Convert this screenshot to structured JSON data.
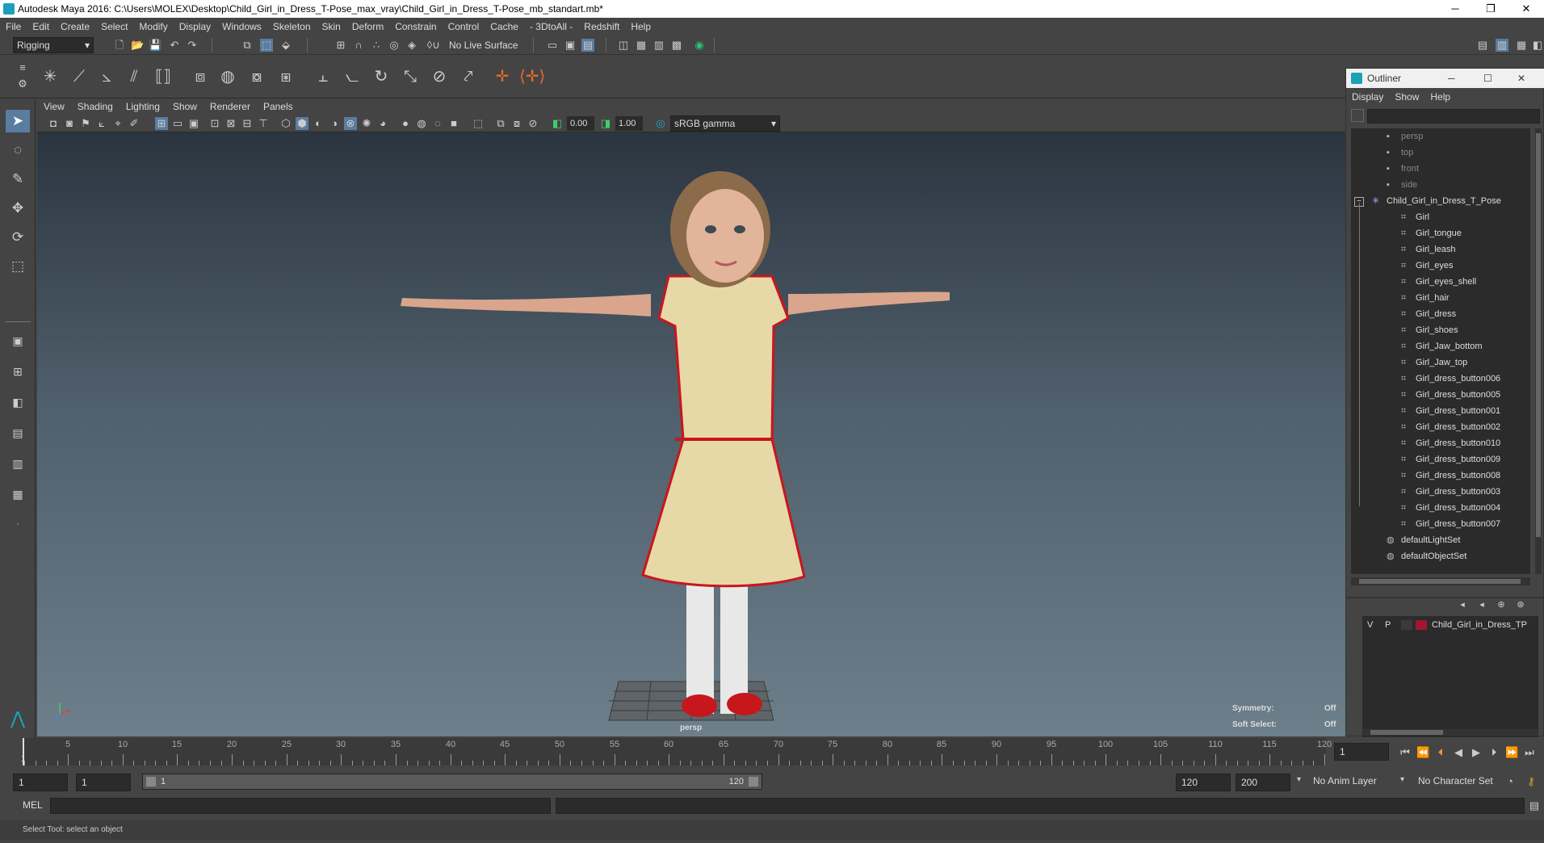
{
  "window": {
    "title": "Autodesk Maya 2016: C:\\Users\\MOLEX\\Desktop\\Child_Girl_in_Dress_T-Pose_max_vray\\Child_Girl_in_Dress_T-Pose_mb_standart.mb*",
    "minimize": "─",
    "restore": "❐",
    "close": "✕"
  },
  "menubar": [
    "File",
    "Edit",
    "Create",
    "Select",
    "Modify",
    "Display",
    "Windows",
    "Skeleton",
    "Skin",
    "Deform",
    "Constrain",
    "Control",
    "Cache",
    "- 3DtoAll -",
    "Redshift",
    "Help"
  ],
  "status": {
    "mode": "Rigging",
    "live_surface": "No Live Surface"
  },
  "panel_menu": [
    "View",
    "Shading",
    "Lighting",
    "Show",
    "Renderer",
    "Panels"
  ],
  "panel_toolbar": {
    "exposure": "0.00",
    "gamma": "1.00",
    "colorspace": "sRGB gamma"
  },
  "viewport": {
    "camera_label": "persp",
    "symmetry_label": "Symmetry:",
    "symmetry_value": "Off",
    "soft_select_label": "Soft Select:",
    "soft_select_value": "Off"
  },
  "timeline": {
    "ticks": [
      "5",
      "10",
      "15",
      "20",
      "25",
      "30",
      "35",
      "40",
      "45",
      "50",
      "55",
      "60",
      "65",
      "70",
      "75",
      "80",
      "85",
      "90",
      "95",
      "100",
      "105",
      "110",
      "115",
      "120"
    ],
    "start_label": "1",
    "current_frame": "1"
  },
  "range": {
    "start": "1",
    "anim_start": "1",
    "slider_start": "1",
    "slider_end": "120",
    "anim_end": "120",
    "end": "200",
    "anim_layer": "No Anim Layer",
    "character_set": "No Character Set"
  },
  "cmdline": {
    "lang": "MEL"
  },
  "helpline": "Select Tool: select an object",
  "outliner": {
    "title": "Outliner",
    "menu": [
      "Display",
      "Show",
      "Help"
    ],
    "cameras": [
      "persp",
      "top",
      "front",
      "side"
    ],
    "group": "Child_Girl_in_Dress_T_Pose",
    "children": [
      "Girl",
      "Girl_tongue",
      "Girl_leash",
      "Girl_eyes",
      "Girl_eyes_shell",
      "Girl_hair",
      "Girl_dress",
      "Girl_shoes",
      "Girl_Jaw_bottom",
      "Girl_Jaw_top",
      "Girl_dress_button006",
      "Girl_dress_button005",
      "Girl_dress_button001",
      "Girl_dress_button002",
      "Girl_dress_button010",
      "Girl_dress_button009",
      "Girl_dress_button008",
      "Girl_dress_button003",
      "Girl_dress_button004",
      "Girl_dress_button007"
    ],
    "sets": [
      "defaultLightSet",
      "defaultObjectSet"
    ]
  },
  "layer": {
    "v": "V",
    "p": "P",
    "name": "Child_Girl_in_Dress_TP",
    "color": "#a01830"
  }
}
